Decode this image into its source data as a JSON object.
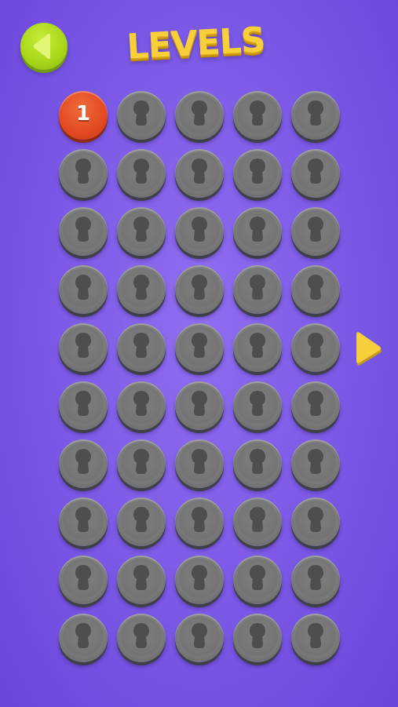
{
  "header": {
    "title": "LEVELS",
    "back_icon": "triangle-left-icon"
  },
  "levels": {
    "columns": 5,
    "rows": 10,
    "total": 50,
    "unlocked": [
      1
    ],
    "items": [
      {
        "number": "1",
        "state": "unlocked"
      },
      {
        "number": "",
        "state": "locked"
      },
      {
        "number": "",
        "state": "locked"
      },
      {
        "number": "",
        "state": "locked"
      },
      {
        "number": "",
        "state": "locked"
      },
      {
        "number": "",
        "state": "locked"
      },
      {
        "number": "",
        "state": "locked"
      },
      {
        "number": "",
        "state": "locked"
      },
      {
        "number": "",
        "state": "locked"
      },
      {
        "number": "",
        "state": "locked"
      },
      {
        "number": "",
        "state": "locked"
      },
      {
        "number": "",
        "state": "locked"
      },
      {
        "number": "",
        "state": "locked"
      },
      {
        "number": "",
        "state": "locked"
      },
      {
        "number": "",
        "state": "locked"
      },
      {
        "number": "",
        "state": "locked"
      },
      {
        "number": "",
        "state": "locked"
      },
      {
        "number": "",
        "state": "locked"
      },
      {
        "number": "",
        "state": "locked"
      },
      {
        "number": "",
        "state": "locked"
      },
      {
        "number": "",
        "state": "locked"
      },
      {
        "number": "",
        "state": "locked"
      },
      {
        "number": "",
        "state": "locked"
      },
      {
        "number": "",
        "state": "locked"
      },
      {
        "number": "",
        "state": "locked"
      },
      {
        "number": "",
        "state": "locked"
      },
      {
        "number": "",
        "state": "locked"
      },
      {
        "number": "",
        "state": "locked"
      },
      {
        "number": "",
        "state": "locked"
      },
      {
        "number": "",
        "state": "locked"
      },
      {
        "number": "",
        "state": "locked"
      },
      {
        "number": "",
        "state": "locked"
      },
      {
        "number": "",
        "state": "locked"
      },
      {
        "number": "",
        "state": "locked"
      },
      {
        "number": "",
        "state": "locked"
      },
      {
        "number": "",
        "state": "locked"
      },
      {
        "number": "",
        "state": "locked"
      },
      {
        "number": "",
        "state": "locked"
      },
      {
        "number": "",
        "state": "locked"
      },
      {
        "number": "",
        "state": "locked"
      },
      {
        "number": "",
        "state": "locked"
      },
      {
        "number": "",
        "state": "locked"
      },
      {
        "number": "",
        "state": "locked"
      },
      {
        "number": "",
        "state": "locked"
      },
      {
        "number": "",
        "state": "locked"
      },
      {
        "number": "",
        "state": "locked"
      },
      {
        "number": "",
        "state": "locked"
      },
      {
        "number": "",
        "state": "locked"
      },
      {
        "number": "",
        "state": "locked"
      },
      {
        "number": "",
        "state": "locked"
      }
    ],
    "locked_icon": "keyhole-icon"
  },
  "navigation": {
    "next_icon": "triangle-right-icon"
  },
  "colors": {
    "background": "#7a58e6",
    "back_button": "#a9d81a",
    "title": "#f7cf3a",
    "unlocked_level": "#e24a22",
    "locked_level": "#7c7c7c",
    "next_arrow": "#f7cf3a"
  }
}
